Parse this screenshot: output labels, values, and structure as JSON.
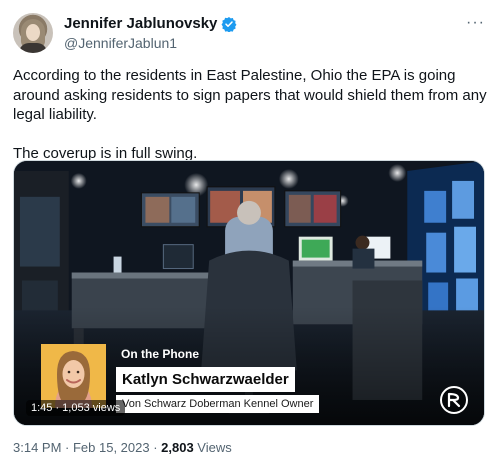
{
  "author": {
    "display_name": "Jennifer Jablunovsky",
    "handle": "@JenniferJablun1",
    "verified_icon": "verified-badge-icon",
    "avatar_icon": "avatar"
  },
  "more_icon": "more-options-icon",
  "tweet": {
    "text_p1": "According to the residents in East Palestine, Ohio the EPA is going around asking residents to sign papers that would shield them from any legal liability.",
    "text_p2": "The coverup is in full swing."
  },
  "video": {
    "on_the_phone": "On the Phone",
    "caller_name": "Katlyn Schwarzwaelder",
    "caller_title": "Von Schwarz Doberman Kennel Owner",
    "duration_views": "1:45 · 1,053 views",
    "brand_icon": "rumble-logo-icon"
  },
  "meta": {
    "time_date": "3:14 PM · Feb 15, 2023 · ",
    "view_count": "2,803",
    "views_label": " Views"
  },
  "colors": {
    "verified_blue": "#1d9bf0",
    "secondary_text": "#536471",
    "headshot_bg": "#f0b848"
  }
}
